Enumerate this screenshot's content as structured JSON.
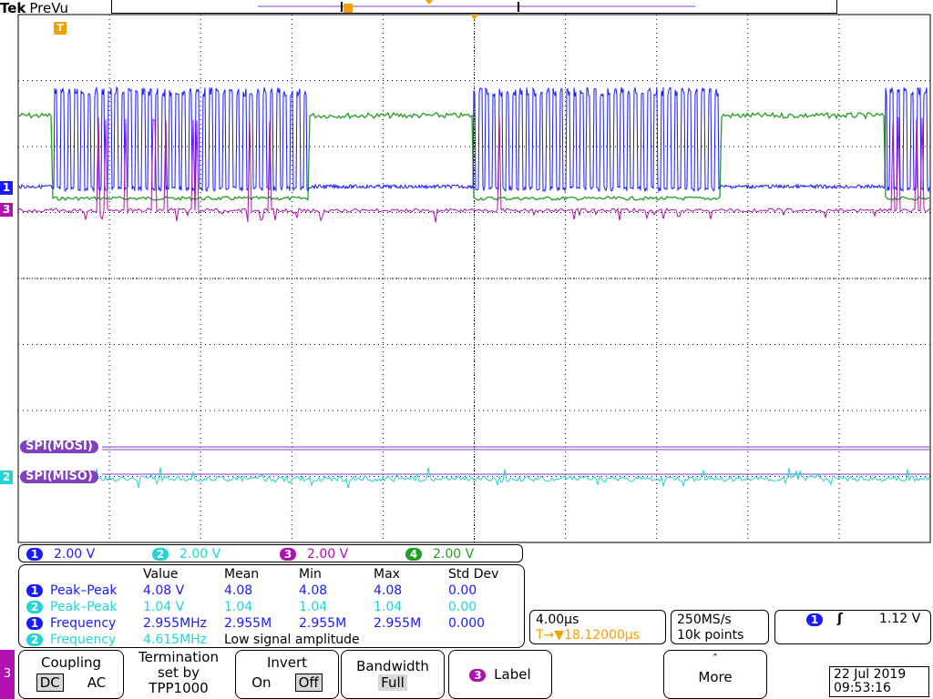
{
  "header": {
    "brand": "Tek",
    "mode": "PreVu"
  },
  "waveform_labels": {
    "ch1_marker": "1",
    "ch3_marker": "3",
    "bus1_label": "SPI(MOSI)",
    "bus2_label": "SPI(MISO)",
    "ch2_marker": "2",
    "trigger_marker": "T"
  },
  "vertical_scales": [
    {
      "channel": "1",
      "value": "2.00 V",
      "color": "#1a1aff"
    },
    {
      "channel": "2",
      "value": "2.00 V",
      "color": "#22d4d4"
    },
    {
      "channel": "3",
      "value": "2.00 V",
      "color": "#b010b0"
    },
    {
      "channel": "4",
      "value": "2.00 V",
      "color": "#20a020"
    }
  ],
  "measurements": {
    "headers": [
      "Value",
      "Mean",
      "Min",
      "Max",
      "Std Dev"
    ],
    "rows": [
      {
        "channel": "1",
        "name": "Peak–Peak",
        "value": "4.08 V",
        "mean": "4.08",
        "min": "4.08",
        "max": "4.08",
        "std": "0.00",
        "color": "#1a1aff"
      },
      {
        "channel": "2",
        "name": "Peak–Peak",
        "value": "1.04 V",
        "mean": "1.04",
        "min": "1.04",
        "max": "1.04",
        "std": "0.00",
        "color": "#22d4d4"
      },
      {
        "channel": "1",
        "name": "Frequency",
        "value": "2.955MHz",
        "mean": "2.955M",
        "min": "2.955M",
        "max": "2.955M",
        "std": "0.000",
        "color": "#1a1aff"
      },
      {
        "channel": "2",
        "name": "Frequency",
        "value": "4.615MHz",
        "note": "Low signal amplitude",
        "color": "#22d4d4"
      }
    ]
  },
  "horizontal": {
    "timebase": "4.00µs",
    "trigger_pos": "▼18.12000µs",
    "trig_icon": "T→"
  },
  "acquisition": {
    "rate": "250MS/s",
    "points": "10k points"
  },
  "trigger": {
    "channel": "1",
    "slope": "ʃ",
    "level": "1.12 V"
  },
  "menu": {
    "channel_tab": "3",
    "coupling": {
      "title": "Coupling",
      "opt1": "DC",
      "opt2": "AC"
    },
    "termination": {
      "line1": "Termination",
      "line2": "set by",
      "line3": "TPP1000"
    },
    "invert": {
      "title": "Invert",
      "opt1": "On",
      "opt2": "Off"
    },
    "bandwidth": {
      "title": "Bandwidth",
      "value": "Full"
    },
    "label": {
      "channel": "3",
      "title": "Label"
    },
    "more": {
      "arrow": "ˆ",
      "title": "More"
    }
  },
  "datetime": {
    "date": "22 Jul  2019",
    "time": "09:53:16"
  }
}
